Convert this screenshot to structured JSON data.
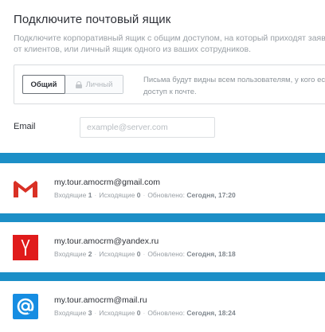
{
  "connect": {
    "title": "Подключите почтовый ящик",
    "desc_line1": "Подключите корпоративный ящик с общим доступом, на который приходят заявки",
    "desc_line2": "от клиентов, или личный ящик одного из ваших сотрудников."
  },
  "access": {
    "shared_label": "Общий",
    "personal_label": "Личный",
    "selected": "Общий",
    "note_line1": "Письма будут видны всем пользователям, у кого есть",
    "note_line2": "доступ к почте."
  },
  "email": {
    "label": "Email",
    "placeholder": "example@server.com",
    "value": ""
  },
  "colors": {
    "divider": "#1c8fc7",
    "gmail_red": "#d93025",
    "yandex_red": "#e01b1b",
    "mailru_blue": "#168de2"
  },
  "mailboxes": [
    {
      "provider_icon": "gmail-icon",
      "address": "my.tour.amocrm@gmail.com",
      "inbox_label": "Входящие",
      "inbox_count": "1",
      "outbox_label": "Исходящие",
      "outbox_count": "0",
      "updated_label": "Обновлено:",
      "updated_value": "Сегодня, 17:20"
    },
    {
      "provider_icon": "yandex-icon",
      "address": "my.tour.amocrm@yandex.ru",
      "inbox_label": "Входящие",
      "inbox_count": "2",
      "outbox_label": "Исходящие",
      "outbox_count": "0",
      "updated_label": "Обновлено:",
      "updated_value": "Сегодня, 18:18"
    },
    {
      "provider_icon": "mailru-icon",
      "address": "my.tour.amocrm@mail.ru",
      "inbox_label": "Входящие",
      "inbox_count": "3",
      "outbox_label": "Исходящие",
      "outbox_count": "0",
      "updated_label": "Обновлено:",
      "updated_value": "Сегодня, 18:24"
    }
  ]
}
